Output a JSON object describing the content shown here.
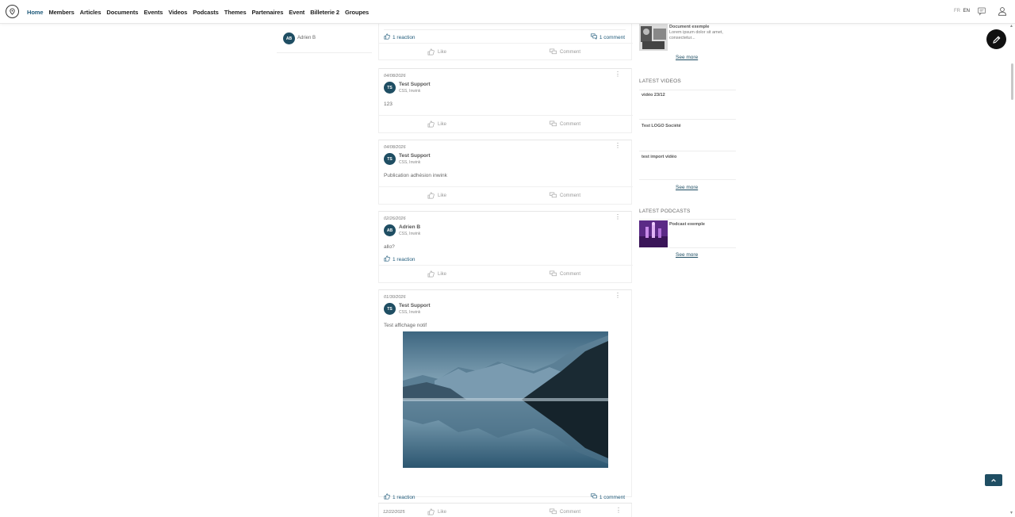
{
  "nav": {
    "items": [
      "Home",
      "Members",
      "Articles",
      "Documents",
      "Events",
      "Videos",
      "Podcasts",
      "Themes",
      "Partenaires",
      "Event",
      "Billeterie 2",
      "Groupes"
    ],
    "active": "Home"
  },
  "lang": {
    "fr": "FR",
    "en": "EN"
  },
  "left_profile": {
    "initials": "AB",
    "name": "Adrien B"
  },
  "feed": {
    "top_reactions": "1 reaction",
    "top_comments": "1 comment",
    "like_label": "Like",
    "comment_label": "Comment",
    "posts": [
      {
        "date": "04/08/2026",
        "initials": "TS",
        "author": "Test Support",
        "org": "CSS, Inwink",
        "body": "123"
      },
      {
        "date": "04/08/2026",
        "initials": "TS",
        "author": "Test Support",
        "org": "CSS, Inwink",
        "body": "Publication adhésion inwink"
      },
      {
        "date": "02/26/2026",
        "initials": "AB",
        "author": "Adrien B",
        "org": "CSS, Inwink",
        "body": "allo?",
        "reactions": "1 reaction"
      },
      {
        "date": "01/30/2026",
        "initials": "TS",
        "author": "Test Support",
        "org": "CSS, Inwink",
        "body": "Test affichage notif",
        "reactions": "1 reaction",
        "comments": "1 comment"
      },
      {
        "date": "12/22/2025"
      }
    ]
  },
  "right": {
    "document": {
      "title": "Document exemple",
      "desc": "Lorem ipsum dolor sit amet, consectetur..."
    },
    "see_more": "See more",
    "latest_videos_title": "LATEST VIDEOS",
    "videos": [
      "vidéo 23/12",
      "Test LOGO Société",
      "test import vidéo"
    ],
    "latest_podcasts_title": "LATEST PODCASTS",
    "podcast": {
      "title": "Podcast exemple"
    }
  },
  "colors": {
    "accent": "#1f5a7a",
    "avatar": "#1f4e63",
    "fab": "#111111"
  }
}
